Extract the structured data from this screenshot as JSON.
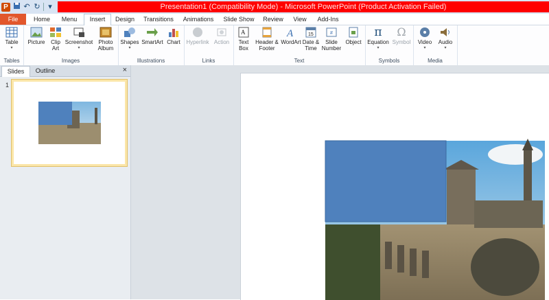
{
  "window": {
    "title": "Presentation1 (Compatibility Mode) - Microsoft PowerPoint (Product Activation Failed)",
    "title_bar_color": "#ff0000"
  },
  "quick_access": {
    "app_icon": "P"
  },
  "tabs": [
    {
      "label": "File"
    },
    {
      "label": "Home"
    },
    {
      "label": "Menu"
    },
    {
      "label": "Insert"
    },
    {
      "label": "Design"
    },
    {
      "label": "Transitions"
    },
    {
      "label": "Animations"
    },
    {
      "label": "Slide Show"
    },
    {
      "label": "Review"
    },
    {
      "label": "View"
    },
    {
      "label": "Add-Ins"
    }
  ],
  "ribbon": {
    "groups": [
      {
        "label": "Tables",
        "buttons": [
          {
            "label": "Table",
            "icon": "table-icon"
          }
        ]
      },
      {
        "label": "Images",
        "buttons": [
          {
            "label": "Picture",
            "icon": "picture-icon"
          },
          {
            "label": "Clip Art",
            "icon": "clip-art-icon"
          },
          {
            "label": "Screenshot",
            "icon": "screenshot-icon"
          },
          {
            "label": "Photo Album",
            "icon": "photo-album-icon"
          }
        ]
      },
      {
        "label": "Illustrations",
        "buttons": [
          {
            "label": "Shapes",
            "icon": "shapes-icon"
          },
          {
            "label": "SmartArt",
            "icon": "smartart-icon"
          },
          {
            "label": "Chart",
            "icon": "chart-icon"
          }
        ]
      },
      {
        "label": "Links",
        "buttons": [
          {
            "label": "Hyperlink",
            "icon": "hyperlink-icon"
          },
          {
            "label": "Action",
            "icon": "action-icon"
          }
        ]
      },
      {
        "label": "Text",
        "buttons": [
          {
            "label": "Text Box",
            "icon": "text-box-icon"
          },
          {
            "label": "Header & Footer",
            "icon": "header-footer-icon"
          },
          {
            "label": "WordArt",
            "icon": "wordart-icon"
          },
          {
            "label": "Date & Time",
            "icon": "date-time-icon"
          },
          {
            "label": "Slide Number",
            "icon": "slide-number-icon"
          },
          {
            "label": "Object",
            "icon": "object-icon"
          }
        ]
      },
      {
        "label": "Symbols",
        "buttons": [
          {
            "label": "Equation",
            "icon": "equation-icon",
            "glyph": "π"
          },
          {
            "label": "Symbol",
            "icon": "symbol-icon",
            "glyph": "Ω"
          }
        ]
      },
      {
        "label": "Media",
        "buttons": [
          {
            "label": "Video",
            "icon": "video-icon"
          },
          {
            "label": "Audio",
            "icon": "audio-icon"
          }
        ]
      }
    ]
  },
  "left_panel": {
    "tabs": [
      {
        "label": "Slides"
      },
      {
        "label": "Outline"
      }
    ],
    "close": "×",
    "slide_number": "1"
  },
  "colors": {
    "accent": "#4f81bd",
    "file_tab": "#e2572c"
  }
}
